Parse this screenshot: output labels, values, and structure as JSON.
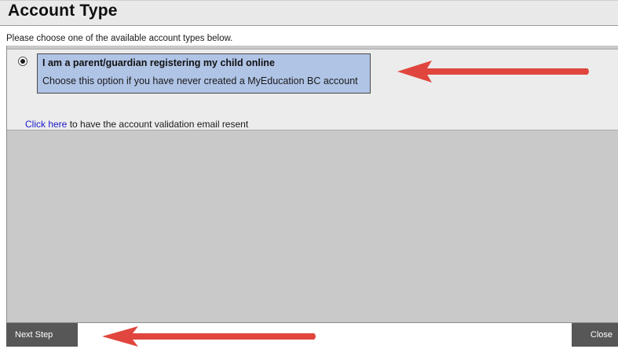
{
  "header": {
    "title": "Account Type"
  },
  "instructions": "Please choose one of the available account types below.",
  "option": {
    "title": "I am a parent/guardian registering my child online",
    "description": "Choose this option if you have never created a MyEducation BC account",
    "selected": true
  },
  "resend": {
    "link_text": "Click here",
    "rest_text": " to have the account validation email resent"
  },
  "footer": {
    "next_label": "Next Step",
    "close_label": "Close"
  },
  "colors": {
    "selected_option_bg": "#b0c4e6",
    "button_bg": "#575757",
    "link": "#1a1acd",
    "annotation_arrow": "#e0463d"
  },
  "annotations": {
    "arrow_icons": [
      "left-arrow-annotation-icon",
      "left-arrow-annotation-icon"
    ]
  }
}
